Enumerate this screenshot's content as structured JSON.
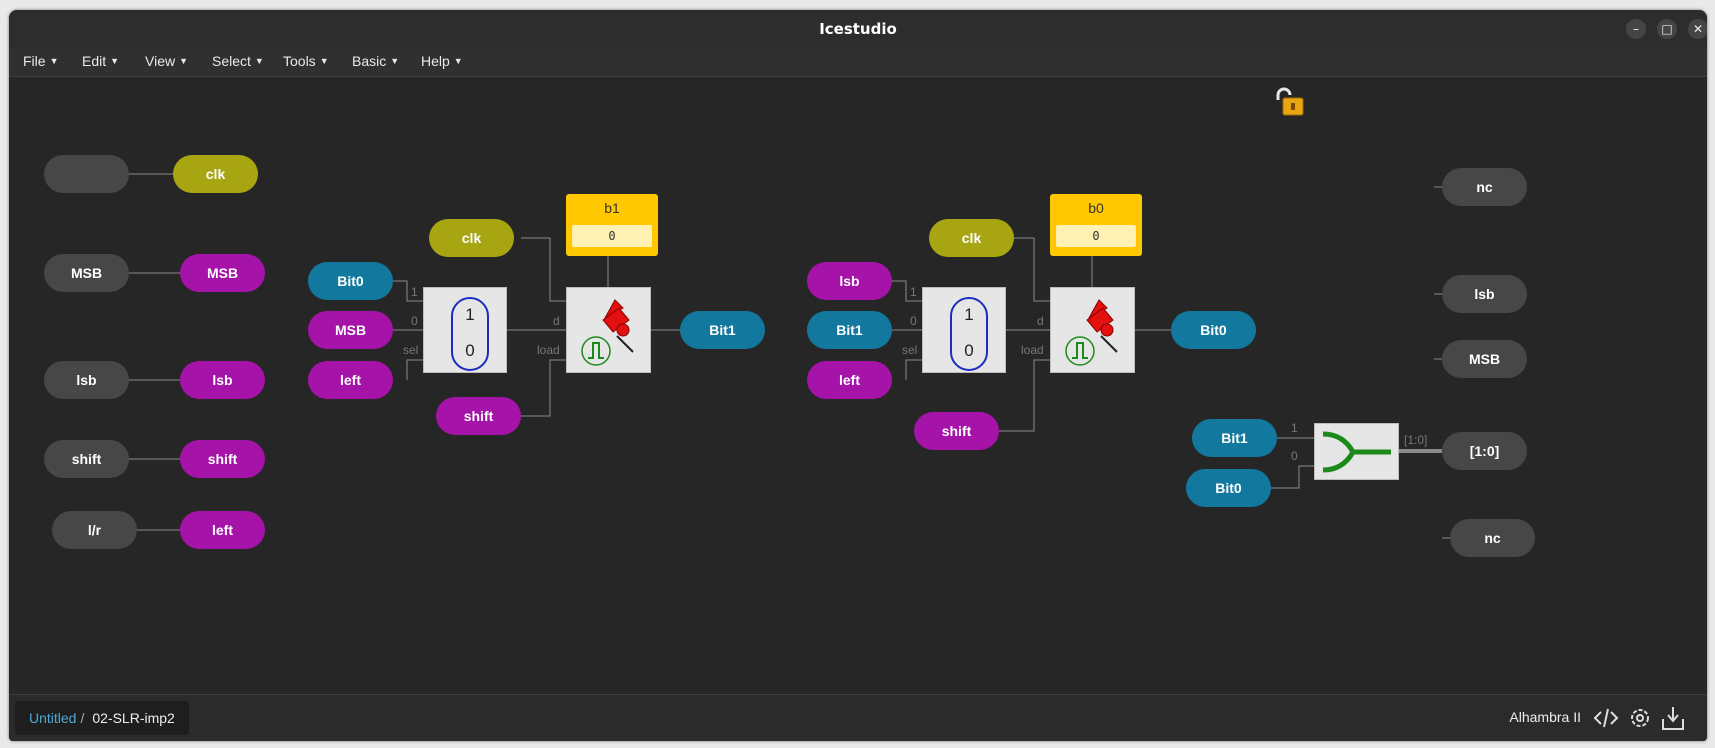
{
  "window": {
    "title": "Icestudio",
    "controls": [
      "–",
      "□",
      "✕"
    ]
  },
  "menu": [
    {
      "label": "File"
    },
    {
      "label": "Edit"
    },
    {
      "label": "View"
    },
    {
      "label": "Select"
    },
    {
      "label": "Tools"
    },
    {
      "label": "Basic"
    },
    {
      "label": "Help"
    }
  ],
  "inputs": [
    {
      "pin": "",
      "label": "clk",
      "color": "olive"
    },
    {
      "pin": "MSB",
      "label": "MSB",
      "color": "magenta"
    },
    {
      "pin": "lsb",
      "label": "lsb",
      "color": "magenta"
    },
    {
      "pin": "shift",
      "label": "shift",
      "color": "magenta"
    },
    {
      "pin": "l/r",
      "label": "left",
      "color": "magenta"
    }
  ],
  "stage1": {
    "mux_inputs": [
      "Bit0",
      "MSB",
      "left"
    ],
    "mux_port_labels": [
      "1",
      "0",
      "sel"
    ],
    "mux_values": [
      "1",
      "0"
    ],
    "clk": "clk",
    "mem": {
      "name": "b1",
      "value": "0"
    },
    "reg_port_labels": [
      "d",
      "load"
    ],
    "load": "shift",
    "output": "Bit1"
  },
  "stage2": {
    "mux_inputs": [
      "lsb",
      "Bit1",
      "left"
    ],
    "mux_port_labels": [
      "1",
      "0",
      "sel"
    ],
    "mux_values": [
      "1",
      "0"
    ],
    "clk": "clk",
    "mem": {
      "name": "b0",
      "value": "0"
    },
    "reg_port_labels": [
      "d",
      "load"
    ],
    "load": "shift",
    "output": "Bit0"
  },
  "outputs": [
    "nc",
    "lsb",
    "MSB",
    "[1:0]",
    "nc"
  ],
  "join": {
    "inputs": [
      "Bit1",
      "Bit0"
    ],
    "port_labels": [
      "1",
      "0"
    ],
    "bus_label": "[1:0]"
  },
  "status": {
    "breadcrumb_root": "Untitled",
    "breadcrumb_sep": "/",
    "breadcrumb_current": "02-SLR-imp2",
    "board": "Alhambra II"
  },
  "colors": {
    "olive": "#a8a513",
    "magenta": "#a513a8",
    "blue": "#13789e",
    "gray": "#474747",
    "memory": "#ffc800",
    "join_icon": "#1b8a1b"
  }
}
